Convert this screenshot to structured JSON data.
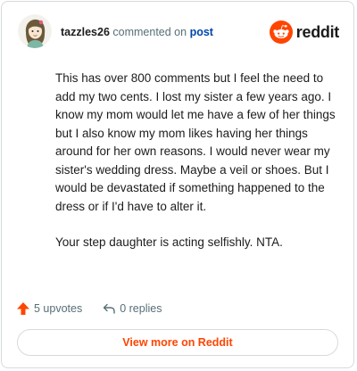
{
  "comment": {
    "username": "tazzles26",
    "verb": "commented on",
    "post_link": "post",
    "paragraphs": [
      "This has over 800 comments but I feel the need to add my two cents. I lost my sister a few years ago. I know my mom would let me have a few of her things but I also know my mom likes having her things around for her own reasons. I would never wear my sister's wedding dress. Maybe a veil or shoes. But I would be devastated if something happened to the dress or if I'd have to alter it.",
      "Your step daughter is acting selfishly. NTA."
    ]
  },
  "brand": {
    "name": "reddit",
    "icon": "reddit-snoo-icon",
    "color": "#ff4500"
  },
  "actions": {
    "upvotes_label": "5 upvotes",
    "upvote_icon": "upvote-arrow-icon",
    "replies_label": "0 replies",
    "reply_icon": "reply-arrow-icon"
  },
  "footer": {
    "view_more_label": "View more on Reddit"
  },
  "avatar": {
    "icon": "user-avatar"
  }
}
